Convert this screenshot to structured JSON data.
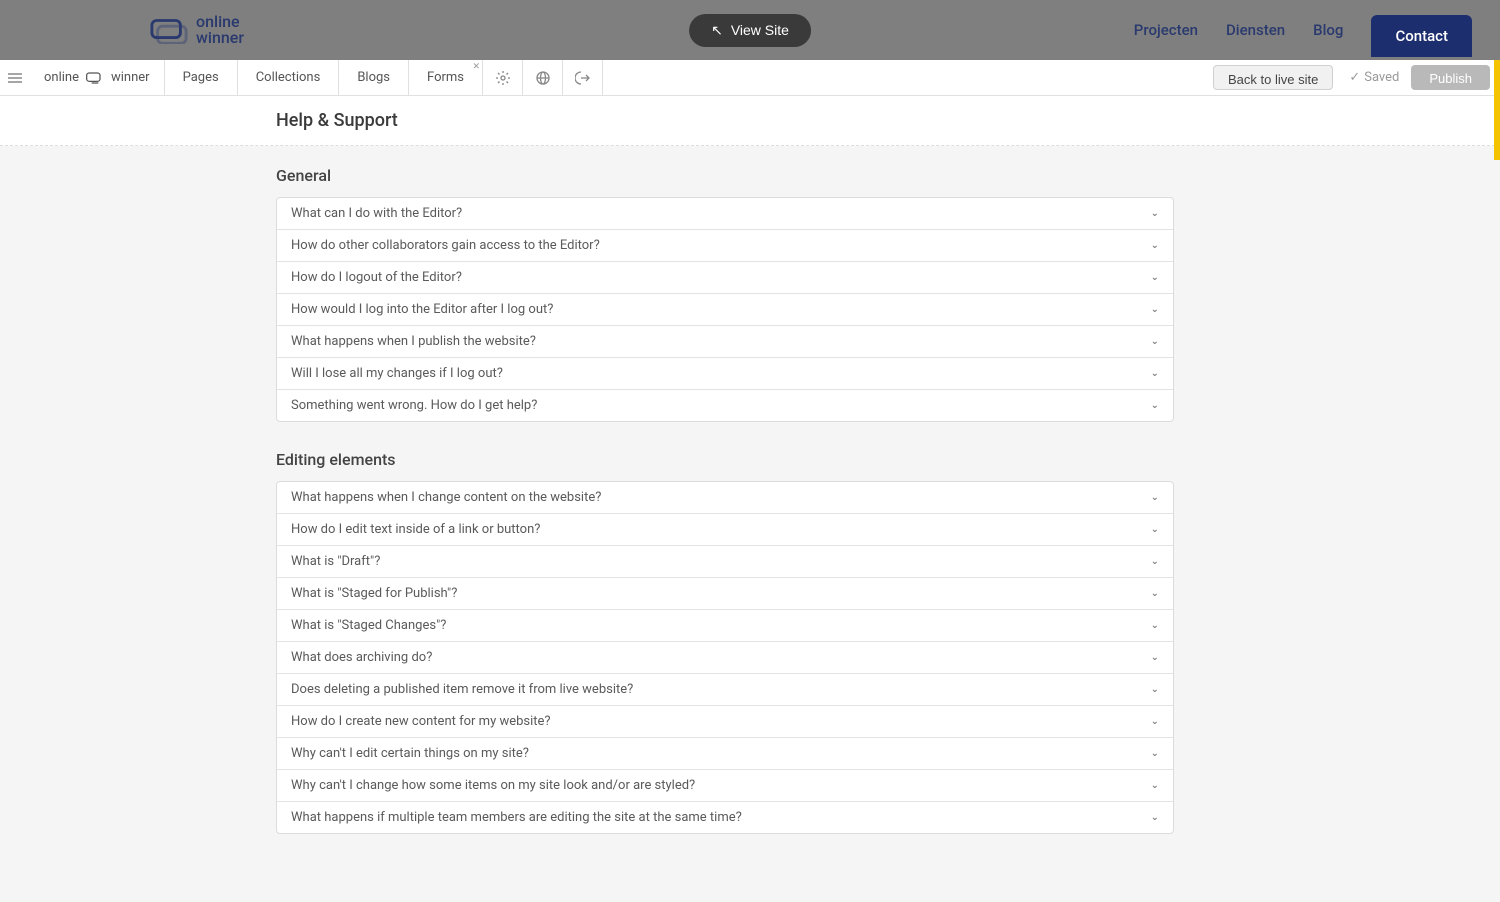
{
  "site_header": {
    "logo_text_1": "online",
    "logo_text_2": "winner",
    "view_site": "View Site",
    "nav": [
      "Projecten",
      "Diensten",
      "Blog"
    ],
    "contact": "Contact"
  },
  "toolbar": {
    "brand": "online",
    "brand2": "winner",
    "tabs": [
      "Pages",
      "Collections",
      "Blogs",
      "Forms"
    ],
    "back_to_live": "Back to live site",
    "saved": "Saved",
    "publish": "Publish"
  },
  "page_title": "Help & Support",
  "sections": [
    {
      "title": "General",
      "items": [
        "What can I do with the Editor?",
        "How do other collaborators gain access to the Editor?",
        "How do I logout of the Editor?",
        "How would I log into the Editor after I log out?",
        "What happens when I publish the website?",
        "Will I lose all my changes if I log out?",
        "Something went wrong. How do I get help?"
      ]
    },
    {
      "title": "Editing elements",
      "items": [
        "What happens when I change content on the website?",
        "How do I edit text inside of a link or button?",
        "What is \"Draft\"?",
        "What is \"Staged for Publish\"?",
        "What is \"Staged Changes\"?",
        "What does archiving do?",
        "Does deleting a published item remove it from live website?",
        "How do I create new content for my website?",
        "Why can't I edit certain things on my site?",
        "Why can't I change how some items on my site look and/or are styled?",
        "What happens if multiple team members are editing the site at the same time?"
      ]
    }
  ]
}
